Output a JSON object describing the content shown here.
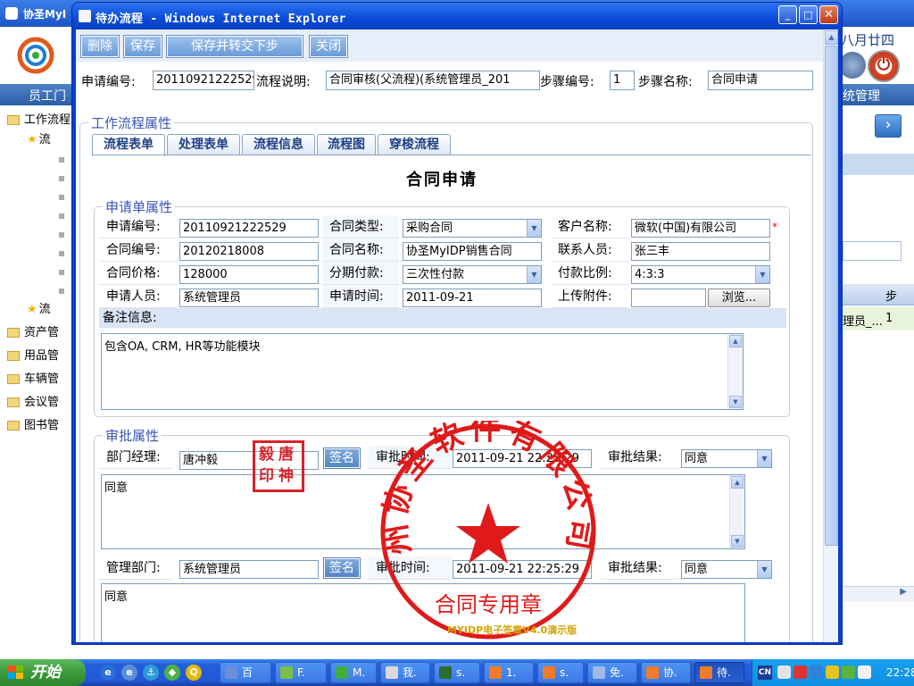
{
  "background_app": {
    "title": "协圣MyI",
    "date_text": "八月廿四",
    "nav_left": "员工门",
    "nav_right": "统管理",
    "tree": [
      {
        "label": "工作流程",
        "type": "folder"
      },
      {
        "label": "流",
        "type": "star"
      },
      {
        "label": "流",
        "type": "star"
      },
      {
        "label": "资产管",
        "type": "folder"
      },
      {
        "label": "用品管",
        "type": "folder"
      },
      {
        "label": "车辆管",
        "type": "folder"
      },
      {
        "label": "会议管",
        "type": "folder"
      },
      {
        "label": "图书管",
        "type": "folder"
      }
    ],
    "grid_header": "步",
    "grid_row": {
      "a": "理员_...",
      "b": "1"
    }
  },
  "popup": {
    "title": "待办流程 - Windows Internet Explorer",
    "toolbar": {
      "delete": "删除",
      "save": "保存",
      "save_next": "保存并转交下步",
      "close": "关闭"
    },
    "info": {
      "apply_no_label": "申请编号:",
      "apply_no_value": "20110921222529",
      "desc_label": "流程说明:",
      "desc_value": "合同审核(父流程)(系统管理员_201",
      "step_no_label": "步骤编号:",
      "step_no_value": "1",
      "step_name_label": "步骤名称:",
      "step_name_value": "合同申请"
    },
    "workflow_legend": "工作流程属性",
    "tabs": [
      "流程表单",
      "处理表单",
      "流程信息",
      "流程图",
      "穿梭流程"
    ],
    "form_title": "合同申请",
    "apply_legend": "申请单属性",
    "apply_fields": {
      "apply_no_label": "申请编号:",
      "apply_no": "20110921222529",
      "contract_type_label": "合同类型:",
      "contract_type": "采购合同",
      "customer_label": "客户名称:",
      "customer": "微软(中国)有限公司",
      "contract_no_label": "合同编号:",
      "contract_no": "20120218008",
      "contract_name_label": "合同名称:",
      "contract_name": "协圣MyIDP销售合同",
      "contact_label": "联系人员:",
      "contact": "张三丰",
      "price_label": "合同价格:",
      "price": "128000",
      "installment_label": "分期付款:",
      "installment": "三次性付款",
      "ratio_label": "付款比例:",
      "ratio": "4:3:3",
      "applicant_label": "申请人员:",
      "applicant": "系统管理员",
      "apply_time_label": "申请时间:",
      "apply_time": "2011-09-21",
      "attachment_label": "上传附件:",
      "browse": "浏览...",
      "remark_label": "备注信息:",
      "remark": "包含OA, CRM, HR等功能模块",
      "required_mark": "*"
    },
    "approve_legend": "审批属性",
    "approve1": {
      "dept_label": "部门经理:",
      "dept_value": "唐冲毅",
      "sign": "签名",
      "time_label": "审批时间:",
      "time_value": "2011-09-21 22:25:29",
      "result_label": "审批结果:",
      "result_value": "同意",
      "comment": "同意"
    },
    "approve2": {
      "dept_label": "管理部门:",
      "dept_value": "系统管理员",
      "sign": "签名",
      "time_label": "审批时间:",
      "time_value": "2011-09-21 22:25:29",
      "result_label": "审批结果:",
      "result_value": "同意",
      "comment": "同意"
    },
    "seal_small": [
      "毅",
      "唐",
      "印",
      "神"
    ],
    "seal_big_text": "州协圣软件有限公司",
    "seal_big_bottom": "合同专用章",
    "watermark": "MYIDP电子签章V4.0演示版"
  },
  "taskbar": {
    "start": "开始",
    "tasks": [
      {
        "label": "百",
        "color": "#6a8fd8"
      },
      {
        "label": "F.",
        "color": "#7bbf4a"
      },
      {
        "label": "M.",
        "color": "#3fae3f"
      },
      {
        "label": "我.",
        "color": "#d9d9d9"
      },
      {
        "label": "s.",
        "color": "#2d6c2d"
      },
      {
        "label": "1.",
        "color": "#f07b2a"
      },
      {
        "label": "s.",
        "color": "#f07b2a"
      },
      {
        "label": "免.",
        "color": "#9fb9e8"
      },
      {
        "label": "协.",
        "color": "#f07b2a"
      },
      {
        "label": "待.",
        "color": "#f07b2a"
      }
    ],
    "tray_lang": "CN",
    "clock": "22:28"
  }
}
